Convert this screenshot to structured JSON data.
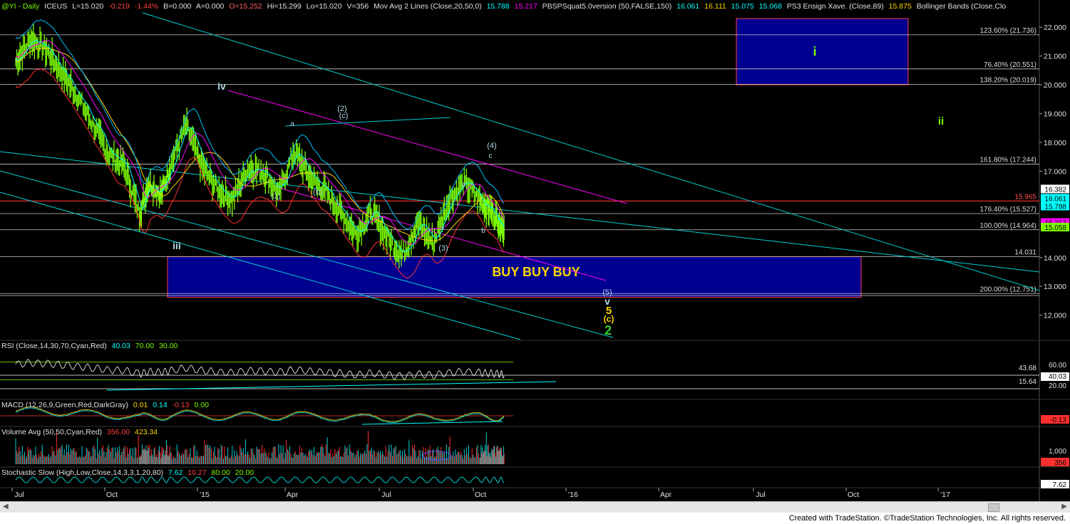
{
  "colors": {
    "background": "#000000",
    "price": "#7CFC00",
    "ma20": "#00FFFF",
    "ma50": "#FF00FF",
    "ensign": "#FFD700",
    "bollinger": "#00BFFF",
    "buy_zone": "#000090",
    "channel": "#00CED1",
    "fib_line": "#FFFFFF",
    "red_line": "#FF3030"
  },
  "header": {
    "symbol": "@YI - Daily",
    "exchange": "ICEUS",
    "last": "L=15.020",
    "change": "-0.219",
    "change_pct": "-1.44%",
    "bid": "B=0.000",
    "ask": "A=0.000",
    "open": "O=15.252",
    "high": "Hi=15.299",
    "low": "Lo=15.020",
    "volume": "V=356",
    "ma_label": "Mov Avg 2 Lines (Close,20,50,0)",
    "ma_v1": "15.788",
    "ma_v2": "15.217",
    "pbs_label": "PBSPSquat5.0version (50,FALSE,150)",
    "pbs_v1": "16.061",
    "pbs_v2": "16.111",
    "pbs_v3": "15.075",
    "pbs_v4": "15.068",
    "ensign_label": "PS3 Ensign Xave. (Close,89)",
    "ensign_v": "15.875",
    "bb_label": "Bollinger Bands (Close,Clo"
  },
  "rsi_header": {
    "label": "RSI (Close,14,30,70,Cyan,Red)",
    "v1": "40.03",
    "v2": "70.00",
    "v3": "30.00"
  },
  "macd_header": {
    "label": "MACD (12,26,9,Green,Red,DarkGray)",
    "v1": "0.01",
    "v2": "0.14",
    "v3": "-0.13",
    "v4": "0.00"
  },
  "volume_header": {
    "label": "Volume Avg (50,50,Cyan,Red)",
    "v1": "356.00",
    "v2": "423.34"
  },
  "stoch_header": {
    "label": "Stochastic Slow (High,Low,Close,14,3,3,1,20,80)",
    "v1": "7.62",
    "v2": "10.27",
    "v3": "80.00",
    "v4": "20.00"
  },
  "chart_data": {
    "type": "candlestick",
    "x_tick_labels": [
      "Jul",
      "Oct",
      "'15",
      "Apr",
      "Jul",
      "Oct",
      "'16",
      "Apr",
      "Jul",
      "Oct",
      "'17"
    ],
    "y_axis": {
      "ticks": [
        "22.000",
        "21.000",
        "20.000",
        "19.000",
        "18.000",
        "17.000",
        "14.000",
        "13.000",
        "12.000"
      ],
      "range": [
        11.2,
        22.5
      ],
      "value_tags": [
        "16.382",
        "16.061",
        "15.788",
        "15.217",
        "15.058"
      ]
    },
    "price_path": {
      "x_months": [
        0,
        0.5,
        1,
        1.5,
        2,
        2.5,
        3,
        3.5,
        4,
        4.3,
        4.7,
        5,
        5.5,
        6,
        6.5,
        7,
        7.5,
        8,
        8.5,
        9,
        9.5,
        10,
        10.5,
        11,
        11.5,
        12,
        12.5,
        13,
        13.5,
        14,
        14.5,
        15,
        15.3,
        15.6,
        15.8
      ],
      "close": [
        20.8,
        21.6,
        21.2,
        20.4,
        19.6,
        18.6,
        17.6,
        17.2,
        15.5,
        16.6,
        16.2,
        17.2,
        18.6,
        17.2,
        16.4,
        16.0,
        17.1,
        17.0,
        16.2,
        17.7,
        16.8,
        16.3,
        15.6,
        14.8,
        15.6,
        14.7,
        14.1,
        15.2,
        14.5,
        16.0,
        16.6,
        16.0,
        15.7,
        15.3,
        15.02
      ]
    },
    "horizontal_levels": [
      {
        "label": "123.60% (21.736)",
        "value": 21.736
      },
      {
        "label": "76.40% (20.551)",
        "value": 20.551
      },
      {
        "label": "138.20% (20.019)",
        "value": 20.019
      },
      {
        "label": "161.80% (17.244)",
        "value": 17.244
      },
      {
        "label": "15.965",
        "value": 15.965
      },
      {
        "label": "176.40% (15.527)",
        "value": 15.527
      },
      {
        "label": "100.00% (14.964)",
        "value": 14.964
      },
      {
        "label": "14.031",
        "value": 14.031
      },
      {
        "label": "200.00% (12.751)",
        "value": 12.751
      }
    ],
    "zones": [
      {
        "label": "BUY BUY BUY",
        "top": 14.031,
        "bottom": 12.62
      },
      {
        "label": "i",
        "top": 22.3,
        "bottom": 20.0
      }
    ],
    "wave_labels": [
      "iv",
      "iii",
      "(1)",
      "(b)",
      "(2)",
      "(c)",
      "a",
      "(3)",
      "(4)",
      "c",
      "a",
      "b",
      "(5)",
      "v",
      "5",
      "(c)",
      "2",
      "ii"
    ],
    "rsi": {
      "levels": [
        70,
        30
      ],
      "tags": [
        "60.00",
        "40.03",
        "20.00",
        "43.68",
        "15.64"
      ]
    },
    "macd": {
      "tag": "-0.13"
    },
    "volume": {
      "tags": [
        "1,000",
        "356"
      ]
    },
    "stochastic": {
      "tag": "7.62"
    }
  },
  "footer": {
    "text": "Created with TradeStation. ©TradeStation Technologies, Inc. All rights reserved."
  }
}
